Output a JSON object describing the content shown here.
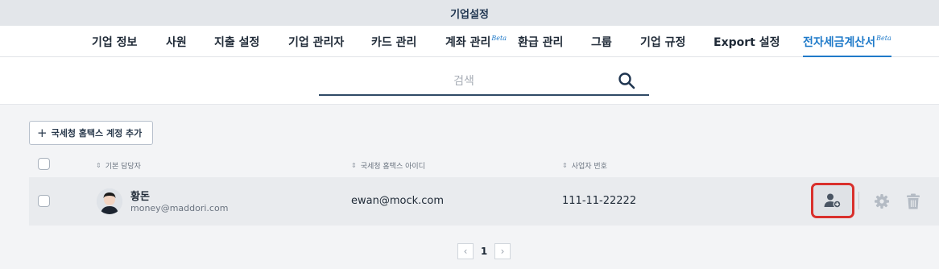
{
  "window": {
    "title": "기업설정"
  },
  "nav": {
    "tabs": [
      {
        "label": "기업 정보"
      },
      {
        "label": "사원"
      },
      {
        "label": "지출 설정"
      },
      {
        "label": "기업 관리자"
      },
      {
        "label": "카드 관리"
      },
      {
        "label": "계좌 관리",
        "badge": "Beta"
      },
      {
        "label": "환급 관리"
      },
      {
        "label": "그룹"
      },
      {
        "label": "기업 규정"
      },
      {
        "label": "Export 설정"
      },
      {
        "label": "전자세금계산서",
        "badge": "Beta",
        "active": true
      }
    ]
  },
  "search": {
    "placeholder": "검색",
    "value": "",
    "icon": "search-icon"
  },
  "toolbar": {
    "add_account_label": "국세청 홈택스 계정 추가",
    "add_icon": "plus-icon"
  },
  "table": {
    "columns": [
      "기본 담당자",
      "국세청 홈택스 아이디",
      "사업자 번호"
    ],
    "rows": [
      {
        "name": "황돈",
        "email": "money@maddori.com",
        "hometax_id": "ewan@mock.com",
        "business_number": "111-11-22222",
        "actions": [
          "user-plus-icon",
          "gear-icon",
          "trash-icon"
        ]
      }
    ]
  },
  "pagination": {
    "current": "1",
    "prev_icon": "chevron-left-icon",
    "next_icon": "chevron-right-icon"
  },
  "colors": {
    "accent": "#1f7ac9",
    "highlight": "#d9302c",
    "row_bg": "#e9ebee"
  }
}
